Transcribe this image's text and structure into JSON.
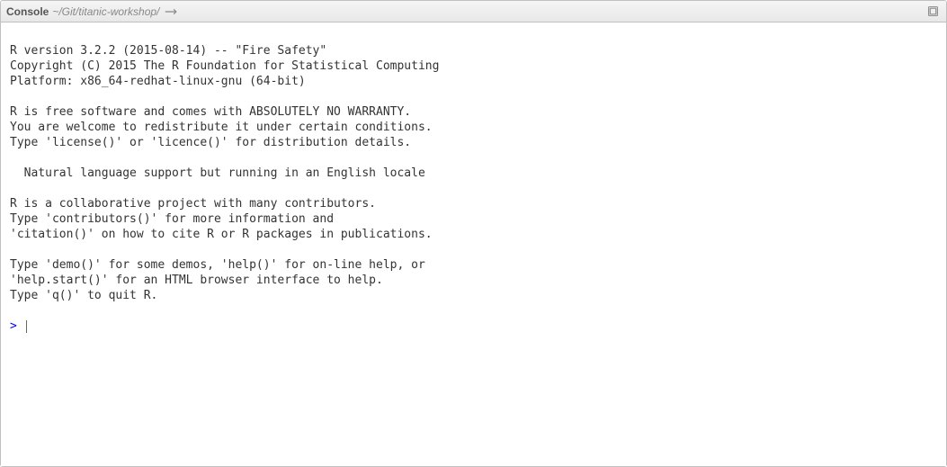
{
  "toolbar": {
    "title": "Console",
    "path": "~/Git/titanic-workshop/"
  },
  "console": {
    "lines": [
      "",
      "R version 3.2.2 (2015-08-14) -- \"Fire Safety\"",
      "Copyright (C) 2015 The R Foundation for Statistical Computing",
      "Platform: x86_64-redhat-linux-gnu (64-bit)",
      "",
      "R is free software and comes with ABSOLUTELY NO WARRANTY.",
      "You are welcome to redistribute it under certain conditions.",
      "Type 'license()' or 'licence()' for distribution details.",
      "",
      "  Natural language support but running in an English locale",
      "",
      "R is a collaborative project with many contributors.",
      "Type 'contributors()' for more information and",
      "'citation()' on how to cite R or R packages in publications.",
      "",
      "Type 'demo()' for some demos, 'help()' for on-line help, or",
      "'help.start()' for an HTML browser interface to help.",
      "Type 'q()' to quit R.",
      ""
    ],
    "prompt": "> "
  }
}
